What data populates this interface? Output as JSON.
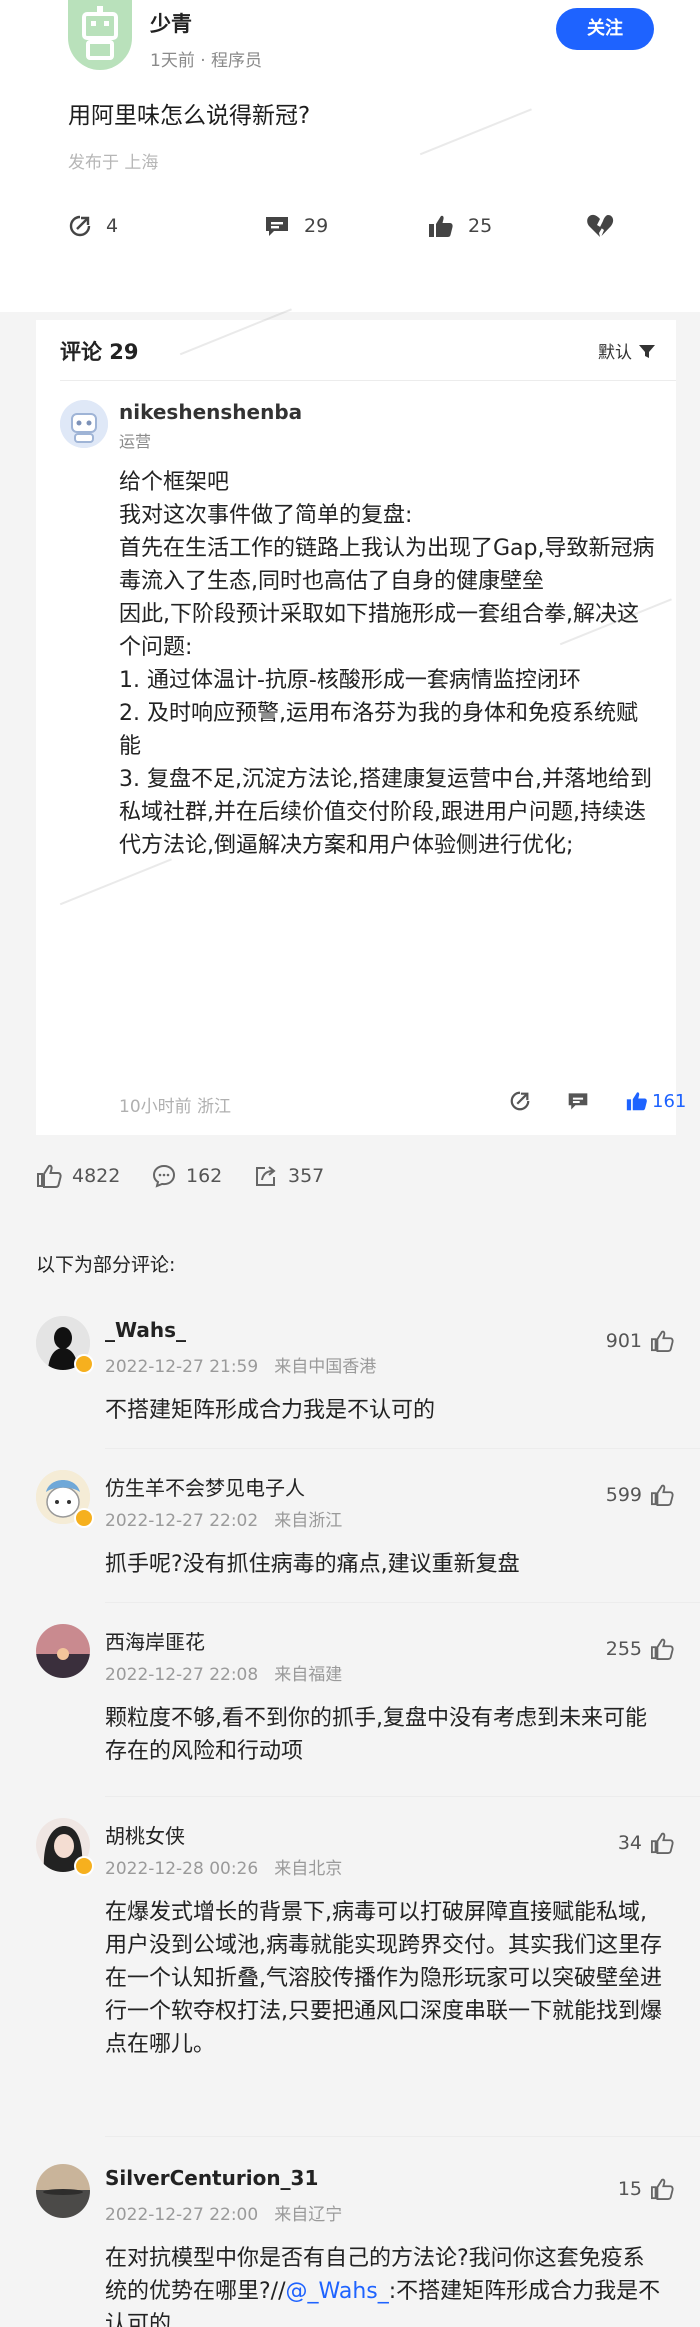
{
  "question": {
    "author_name": "少青",
    "author_meta": "1天前 · 程序员",
    "follow_label": "关注",
    "title": "用阿里味怎么说得新冠?",
    "location": "发布于 上海",
    "actions": {
      "share_count": "4",
      "comment_count": "29",
      "like_count": "25"
    }
  },
  "comments_section": {
    "header": "评论 29",
    "sort_label": "默认",
    "top_comment": {
      "author": "nikeshenshenba",
      "role": "运营",
      "lines": [
        "给个框架吧",
        "我对这次事件做了简单的复盘:",
        "首先在生活工作的链路上我认为出现了Gap,导致新冠病毒流入了生态,同时也高估了自身的健康壁垒",
        "因此,下阶段预计采取如下措施形成一套组合拳,解决这个问题:",
        "1. 通过体温计-抗原-核酸形成一套病情监控闭环",
        "2. 及时响应预警,运用布洛芬为我的身体和免疫系统赋能",
        "3. 复盘不足,沉淀方法论,搭建康复运营中台,并落地给到私域社群,并在后续价值交付阶段,跟进用户问题,持续迭代方法论,倒逼解决方案和用户体验侧进行优化;"
      ],
      "time": "10小时前 浙江",
      "likes": "161"
    }
  },
  "stats": {
    "likes": "4822",
    "comments": "162",
    "shares": "357"
  },
  "partial_label": "以下为部分评论:",
  "replies": [
    {
      "name": "_Wahs_",
      "date": "2022-12-27 21:59",
      "origin": "来自中国香港",
      "likes": "901",
      "body": "不搭建矩阵形成合力我是不认可的"
    },
    {
      "name": "仿生羊不会梦见电子人",
      "date": "2022-12-27 22:02",
      "origin": "来自浙江",
      "likes": "599",
      "body": "抓手呢?没有抓住病毒的痛点,建议重新复盘"
    },
    {
      "name": "西海岸匪花",
      "date": "2022-12-27 22:08",
      "origin": "来自福建",
      "likes": "255",
      "body": "颗粒度不够,看不到你的抓手,复盘中没有考虑到未来可能存在的风险和行动项"
    },
    {
      "name": "胡桃女侠",
      "date": "2022-12-28 00:26",
      "origin": "来自北京",
      "likes": "34",
      "body": "在爆发式增长的背景下,病毒可以打破屏障直接赋能私域,用户没到公域池,病毒就能实现跨界交付。其实我们这里存在一个认知折叠,气溶胶传播作为隐形玩家可以突破壁垒进行一个软夺权打法,只要把通风口深度串联一下就能找到爆点在哪儿。"
    },
    {
      "name": "SilverCenturion_31",
      "date": "2022-12-27 22:00",
      "origin": "来自辽宁",
      "likes": "15",
      "body_prefix": "在对抗模型中你是否有自己的方法论?我问你这套免疫系统的优势在哪里?//",
      "mention": "@_Wahs_",
      "body_suffix": ":不搭建矩阵形成合力我是不认可的"
    }
  ]
}
